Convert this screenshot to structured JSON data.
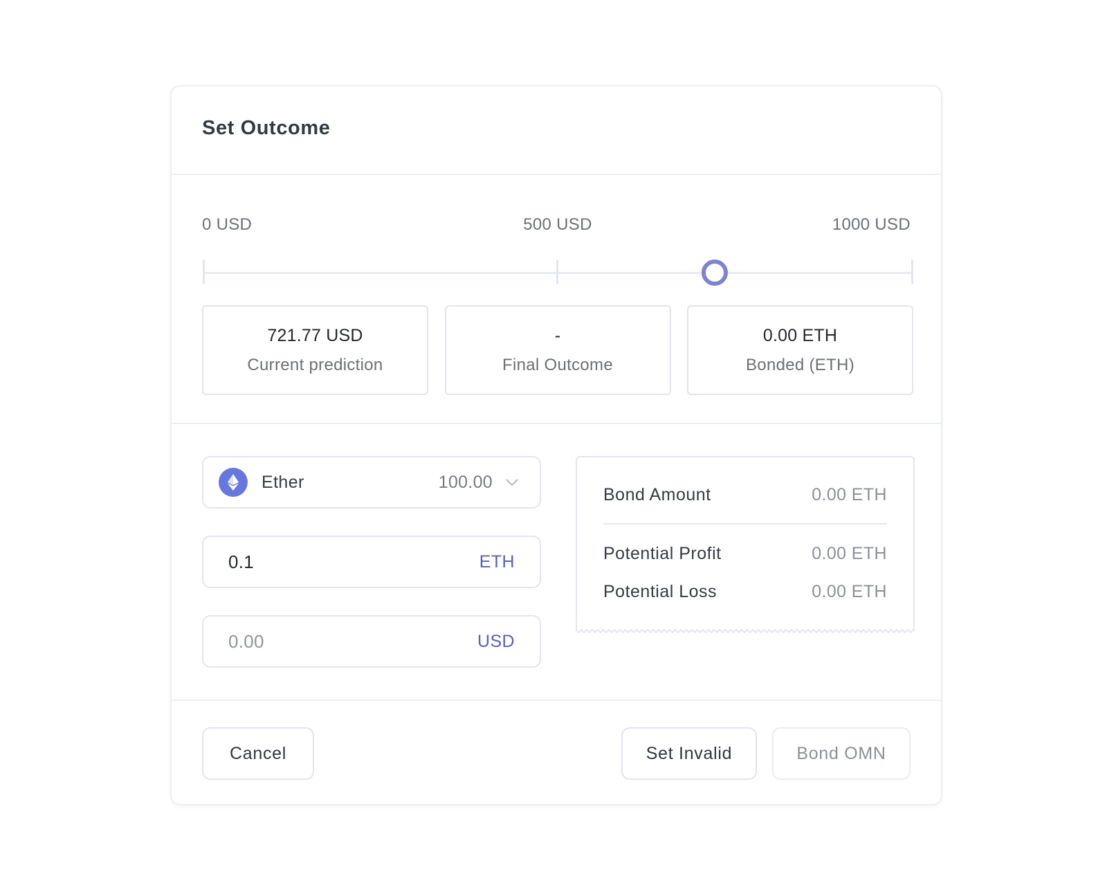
{
  "modal": {
    "title": "Set Outcome"
  },
  "slider": {
    "min_label": "0 USD",
    "mid_label": "500 USD",
    "max_label": "1000 USD",
    "min": 0,
    "max": 1000,
    "value": 721.77
  },
  "stats": [
    {
      "value": "721.77 USD",
      "label": "Current prediction"
    },
    {
      "value": "-",
      "label": "Final Outcome"
    },
    {
      "value": "0.00 ETH",
      "label": "Bonded (ETH)"
    }
  ],
  "token_select": {
    "icon": "ethereum-icon",
    "name": "Ether",
    "balance": "100.00"
  },
  "amount_eth": {
    "value": "0.1",
    "unit": "ETH"
  },
  "amount_usd": {
    "placeholder": "0.00",
    "unit": "USD"
  },
  "summary": {
    "bond_amount_label": "Bond Amount",
    "bond_amount_value": "0.00 ETH",
    "profit_label": "Potential Profit",
    "profit_value": "0.00 ETH",
    "loss_label": "Potential Loss",
    "loss_value": "0.00 ETH"
  },
  "footer": {
    "cancel_label": "Cancel",
    "set_invalid_label": "Set Invalid",
    "bond_label": "Bond OMN"
  },
  "colors": {
    "accent": "#7b84cf",
    "unit_text": "#5562b8",
    "eth_icon_bg": "#6677dd",
    "border": "#e3e5ef"
  }
}
